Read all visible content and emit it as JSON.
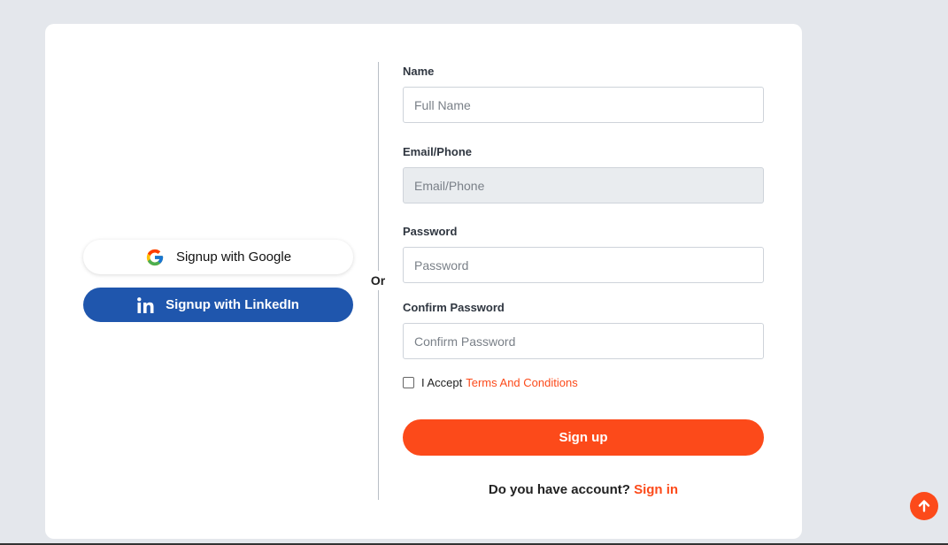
{
  "social": {
    "google_label": "Signup with Google",
    "google_icon": "google-g-icon",
    "linkedin_label": "Signup with LinkedIn",
    "linkedin_icon": "linkedin-icon"
  },
  "divider": {
    "or_text": "Or"
  },
  "form": {
    "name": {
      "label": "Name",
      "placeholder": "Full Name",
      "value": ""
    },
    "email": {
      "label": "Email/Phone",
      "placeholder": "Email/Phone",
      "value": ""
    },
    "password": {
      "label": "Password",
      "placeholder": "Password",
      "value": ""
    },
    "confirm_password": {
      "label": "Confirm Password",
      "placeholder": "Confirm Password",
      "value": ""
    },
    "terms": {
      "prefix": "I Accept",
      "link": "Terms And Conditions",
      "checked": false
    },
    "submit_label": "Sign up",
    "signin_prompt": "Do you have account?",
    "signin_link": "Sign in"
  },
  "scroll_top": {
    "icon": "arrow-up-icon"
  },
  "colors": {
    "accent": "#fc4a1a",
    "linkedin": "#1f56ad",
    "background": "#e4e7ec",
    "card": "#ffffff"
  }
}
